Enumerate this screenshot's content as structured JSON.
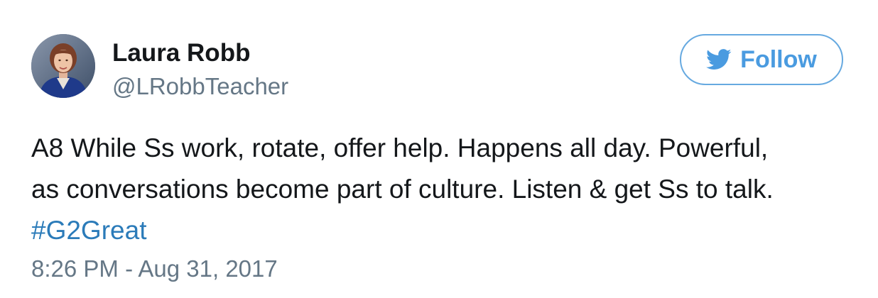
{
  "author": {
    "name": "Laura Robb",
    "handle": "@LRobbTeacher",
    "avatar": "author-portrait"
  },
  "follow_button": {
    "label": "Follow",
    "icon": "twitter-bird-icon",
    "color": "#4a9be0"
  },
  "tweet": {
    "lines": [
      "A8 While Ss work, rotate, offer help. Happens all day. Powerful,",
      "as conversations become part of culture. Listen & get Ss to talk."
    ],
    "hashtag": "#G2Great",
    "timestamp": "8:26 PM - Aug 31, 2017"
  },
  "colors": {
    "text": "#14171a",
    "secondary": "#657786",
    "link": "#2b7bb9",
    "button_border": "#66a9e0"
  }
}
